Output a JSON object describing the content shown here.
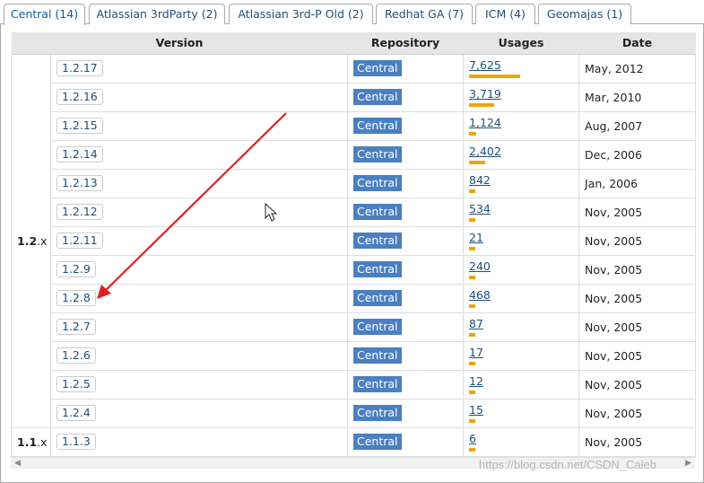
{
  "tabs": [
    {
      "label": "Central (14)",
      "active": true
    },
    {
      "label": "Atlassian 3rdParty (2)"
    },
    {
      "label": "Atlassian 3rd-P Old (2)"
    },
    {
      "label": "Redhat GA (7)"
    },
    {
      "label": "ICM (4)"
    },
    {
      "label": "Geomajas (1)"
    }
  ],
  "table": {
    "headers": [
      "Version",
      "Repository",
      "Usages",
      "Date"
    ],
    "groups": [
      {
        "major": "1.2",
        "suffix": ".x",
        "rows": [
          {
            "version": "1.2.17",
            "repo": "Central",
            "usages": "7,625",
            "usage_value": 7625,
            "date": "May, 2012"
          },
          {
            "version": "1.2.16",
            "repo": "Central",
            "usages": "3,719",
            "usage_value": 3719,
            "date": "Mar, 2010"
          },
          {
            "version": "1.2.15",
            "repo": "Central",
            "usages": "1,124",
            "usage_value": 1124,
            "date": "Aug, 2007"
          },
          {
            "version": "1.2.14",
            "repo": "Central",
            "usages": "2,402",
            "usage_value": 2402,
            "date": "Dec, 2006"
          },
          {
            "version": "1.2.13",
            "repo": "Central",
            "usages": "842",
            "usage_value": 842,
            "date": "Jan, 2006"
          },
          {
            "version": "1.2.12",
            "repo": "Central",
            "usages": "534",
            "usage_value": 534,
            "date": "Nov, 2005"
          },
          {
            "version": "1.2.11",
            "repo": "Central",
            "usages": "21",
            "usage_value": 21,
            "date": "Nov, 2005"
          },
          {
            "version": "1.2.9",
            "repo": "Central",
            "usages": "240",
            "usage_value": 240,
            "date": "Nov, 2005"
          },
          {
            "version": "1.2.8",
            "repo": "Central",
            "usages": "468",
            "usage_value": 468,
            "date": "Nov, 2005"
          },
          {
            "version": "1.2.7",
            "repo": "Central",
            "usages": "87",
            "usage_value": 87,
            "date": "Nov, 2005"
          },
          {
            "version": "1.2.6",
            "repo": "Central",
            "usages": "17",
            "usage_value": 17,
            "date": "Nov, 2005"
          },
          {
            "version": "1.2.5",
            "repo": "Central",
            "usages": "12",
            "usage_value": 12,
            "date": "Nov, 2005"
          },
          {
            "version": "1.2.4",
            "repo": "Central",
            "usages": "15",
            "usage_value": 15,
            "date": "Nov, 2005"
          }
        ]
      },
      {
        "major": "1.1",
        "suffix": ".x",
        "rows": [
          {
            "version": "1.1.3",
            "repo": "Central",
            "usages": "6",
            "usage_value": 6,
            "date": "Nov, 2005"
          }
        ]
      }
    ]
  },
  "colors": {
    "usage_bar": "#f0a30a",
    "repo_badge": "#4a7fc1",
    "annotation_arrow": "#e02020"
  },
  "watermark": "https://blog.csdn.net/CSDN_Caleb",
  "icons": {
    "scroll_left": "left-arrow-icon",
    "scroll_right": "right-arrow-icon",
    "cursor": "mouse-pointer-icon",
    "annotation": "red-arrow-icon"
  }
}
